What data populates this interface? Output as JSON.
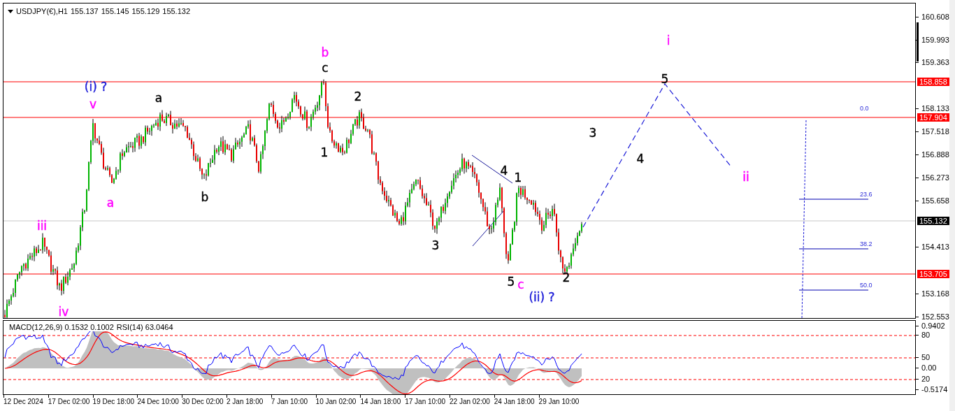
{
  "header": {
    "symbol": "USDJPY(€),H1",
    "quotes": [
      "155.137",
      "155.145",
      "155.129",
      "155.132"
    ]
  },
  "wave_labels": [
    {
      "text": "(i) ?",
      "color": "#1c1cd8"
    },
    {
      "text": "v",
      "color": "#ff00ff"
    },
    {
      "text": "a",
      "color": "#000000"
    },
    {
      "text": "iii",
      "color": "#ff00ff"
    },
    {
      "text": "a",
      "color": "#ff00ff"
    },
    {
      "text": "iv",
      "color": "#ff00ff"
    },
    {
      "text": "b",
      "color": "#000000"
    },
    {
      "text": "b",
      "color": "#ff00ff"
    },
    {
      "text": "c",
      "color": "#000000"
    },
    {
      "text": "1",
      "color": "#000000"
    },
    {
      "text": "2",
      "color": "#000000"
    },
    {
      "text": "3",
      "color": "#000000"
    },
    {
      "text": "4",
      "color": "#000000"
    },
    {
      "text": "1",
      "color": "#000000"
    },
    {
      "text": "5",
      "color": "#000000"
    },
    {
      "text": "c",
      "color": "#ff00ff"
    },
    {
      "text": "(ii) ?",
      "color": "#1c1cd8"
    },
    {
      "text": "2",
      "color": "#000000"
    },
    {
      "text": "3",
      "color": "#000000"
    },
    {
      "text": "4",
      "color": "#000000"
    },
    {
      "text": "5",
      "color": "#000000"
    },
    {
      "text": "i",
      "color": "#ff00ff"
    },
    {
      "text": "ii",
      "color": "#ff00ff"
    }
  ],
  "price_scale": [
    "160.608",
    "159.993",
    "159.363",
    "158.133",
    "157.518",
    "156.888",
    "156.273",
    "155.658",
    "154.413",
    "153.168",
    "152.553"
  ],
  "price_levels": [
    {
      "label": "158.858",
      "kind": "level",
      "color": "#ff0000"
    },
    {
      "label": "157.904",
      "kind": "level",
      "color": "#ff0000"
    },
    {
      "label": "155.132",
      "kind": "bid",
      "color": "#000000"
    },
    {
      "label": "153.705",
      "kind": "level",
      "color": "#ff0000"
    }
  ],
  "fib_levels": [
    "0.0",
    "23.6",
    "38.2",
    "50.0"
  ],
  "indicator": {
    "macd": "MACD(12,26,9) 0.1532 0.1002",
    "rsi": "RSI(14) 63.0464",
    "scale": [
      "0.9402",
      "80",
      "50",
      "0.00",
      "20",
      "-0.5174"
    ]
  },
  "time_axis": [
    "12 Dec 2024",
    "17 Dec 02:00",
    "19 Dec 18:00",
    "24 Dec 10:00",
    "30 Dec 02:00",
    "2 Jan 18:00",
    "7 Jan 10:00",
    "10 Jan 02:00",
    "14 Jan 18:00",
    "17 Jan 10:00",
    "22 Jan 02:00",
    "24 Jan 18:00",
    "29 Jan 10:00"
  ]
}
